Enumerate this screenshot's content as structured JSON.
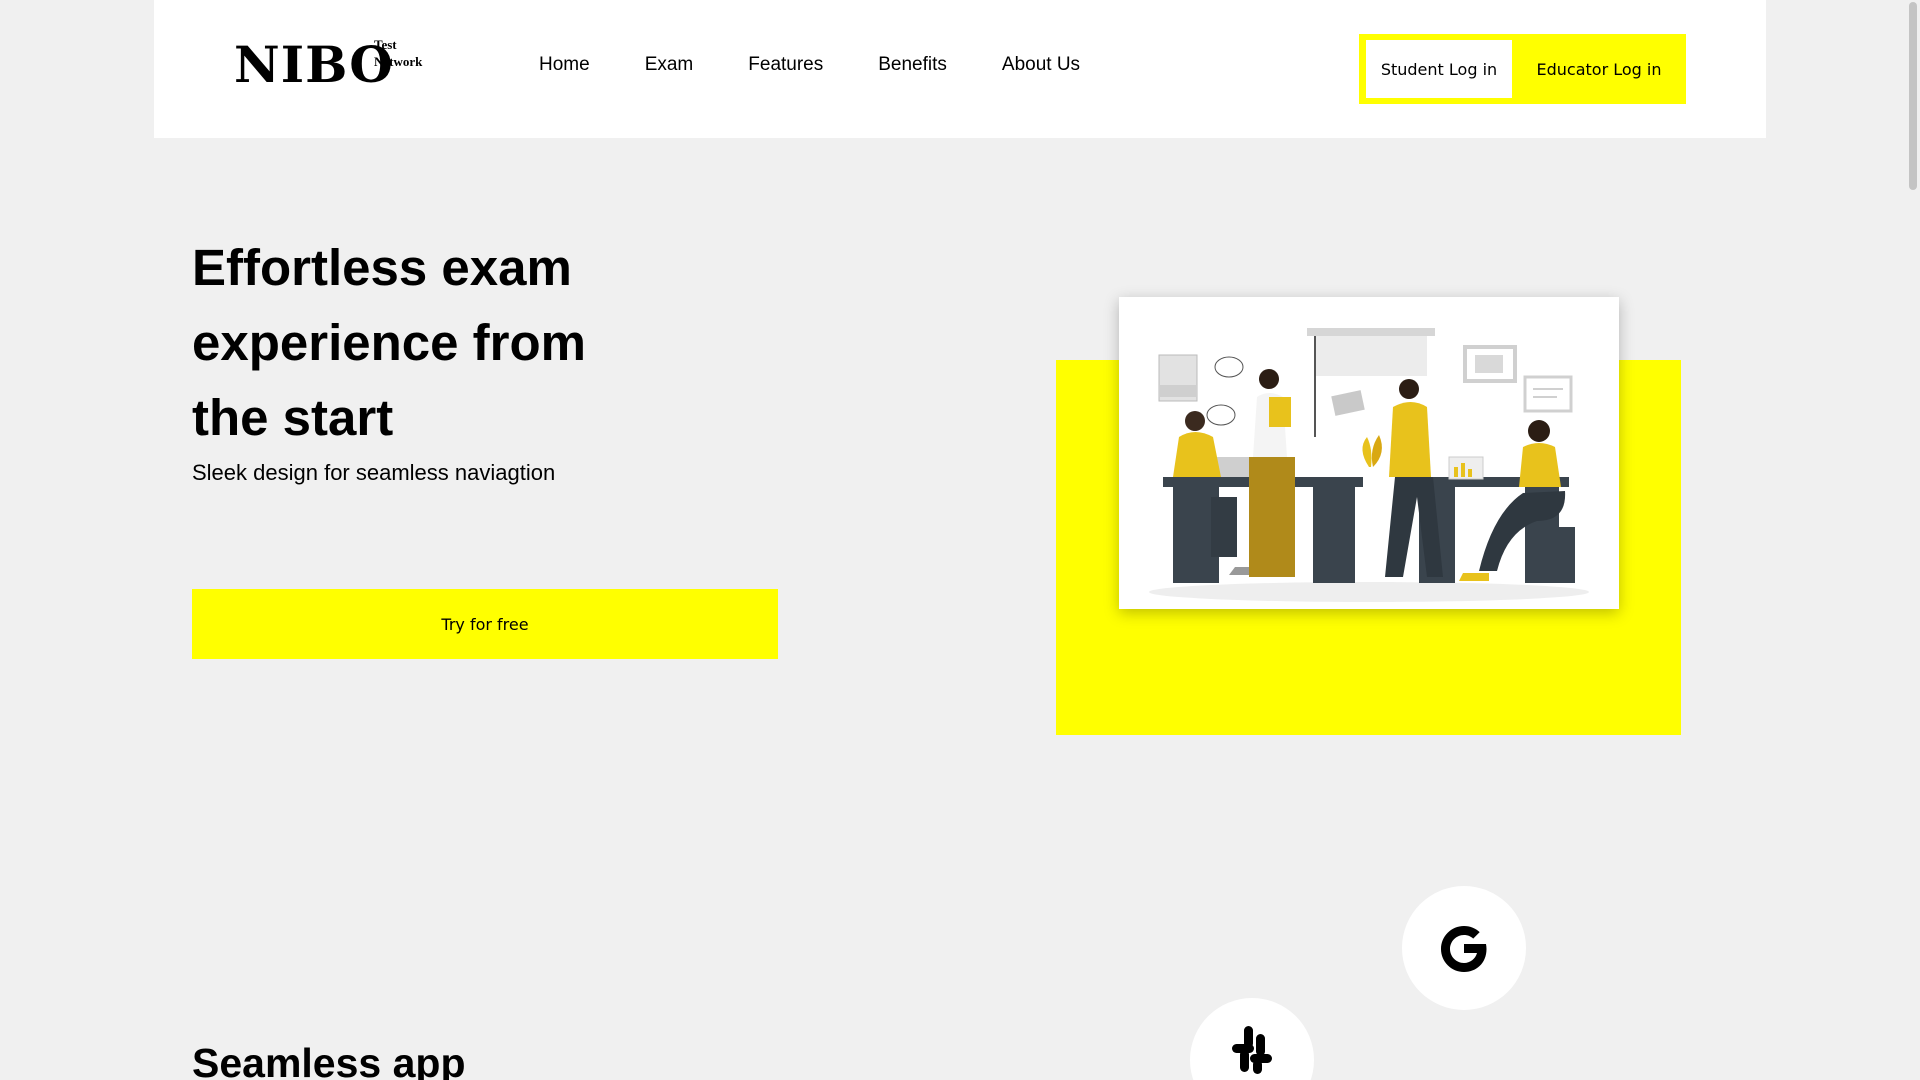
{
  "header": {
    "logo_main": "NIBO",
    "logo_sup_1": "Test",
    "logo_sup_2": "Network",
    "nav": [
      "Home",
      "Exam",
      "Features",
      "Benefits",
      "About Us"
    ],
    "student_login": "Student Log in",
    "educator_login": "Educator Log in"
  },
  "hero": {
    "title_lines": [
      "Effortless exam",
      "experience from",
      "the start"
    ],
    "subtitle": "Sleek design for seamless naviagtion",
    "cta": "Try for free"
  },
  "section2": {
    "title": "Seamless app"
  },
  "icons": {
    "google": "google-icon",
    "slack": "slack-icon"
  },
  "colors": {
    "accent": "#ffff00",
    "background": "#f0f0f0",
    "header_bg": "#ffffff"
  }
}
